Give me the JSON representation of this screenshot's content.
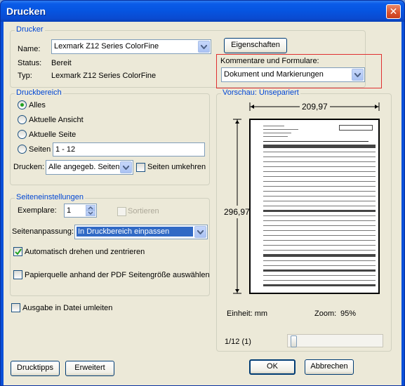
{
  "window": {
    "title": "Drucken",
    "close_glyph": "✕"
  },
  "printer": {
    "legend": "Drucker",
    "name_label": "Name:",
    "name_value": "Lexmark Z12 Series ColorFine",
    "properties_button": "Eigenschaften",
    "status_label": "Status:",
    "status_value": "Bereit",
    "type_label": "Typ:",
    "type_value": "Lexmark Z12 Series ColorFine",
    "comments_label": "Kommentare und Formulare:",
    "comments_value": "Dokument und Markierungen"
  },
  "range": {
    "legend": "Druckbereich",
    "options": [
      "Alles",
      "Aktuelle Ansicht",
      "Aktuelle Seite",
      "Seiten"
    ],
    "selected": "Alles",
    "pages_value": "1 - 12",
    "print_label": "Drucken:",
    "print_value": "Alle angegeb. Seiten",
    "reverse_label": "Seiten umkehren",
    "reverse_checked": false
  },
  "page_settings": {
    "legend": "Seiteneinstellungen",
    "copies_label": "Exemplare:",
    "copies_value": "1",
    "collate_label": "Sortieren",
    "collate_checked": false,
    "scaling_label": "Seitenanpassung:",
    "scaling_value": "In Druckbereich einpassen",
    "autorotate_label": "Automatisch drehen und zentrieren",
    "autorotate_checked": true,
    "papersource_label": "Papierquelle anhand der PDF Seitengröße auswählen",
    "papersource_checked": false
  },
  "print_to_file_label": "Ausgabe in Datei umleiten",
  "print_to_file_checked": false,
  "preview": {
    "legend": "Vorschau: Unsepariert",
    "width_value": "209,97",
    "height_value": "296,97",
    "unit_label": "Einheit: mm",
    "zoom_label": "Zoom:",
    "zoom_value": "95%",
    "page_indicator": "1/12 (1)",
    "page_slider_fraction": 0.0
  },
  "buttons": {
    "tips": "Drucktipps",
    "advanced": "Erweitert",
    "ok": "OK",
    "cancel": "Abbrechen"
  },
  "colors": {
    "accent": "#0046d5",
    "highlight_box": "#e03030",
    "selection": "#316ac5"
  }
}
